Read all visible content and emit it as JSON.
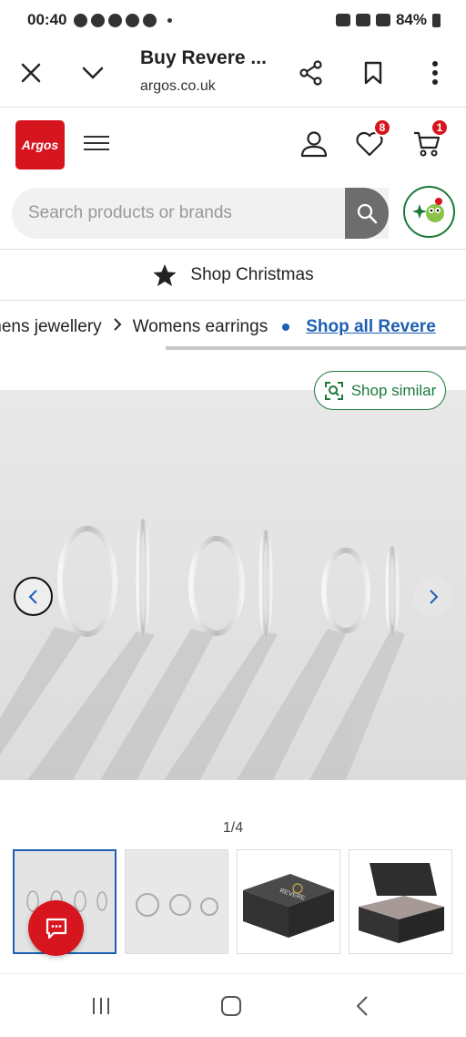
{
  "status_bar": {
    "time": "00:40",
    "battery": "84%"
  },
  "browser": {
    "title": "Buy Revere ...",
    "url": "argos.co.uk"
  },
  "header": {
    "logo_text": "Argos",
    "wishlist_count": "8",
    "basket_count": "1",
    "search_placeholder": "Search products or brands"
  },
  "promo": {
    "label": "Shop Christmas"
  },
  "breadcrumb": {
    "items": [
      "mens jewellery",
      "Womens earrings"
    ],
    "shop_all_link": "Shop all Revere"
  },
  "gallery": {
    "shop_similar_label": "Shop similar",
    "counter": "1/4",
    "thumbnails": [
      "hoops-in-row",
      "hoops-flat",
      "gift-box-closed",
      "gift-box-open"
    ],
    "box_brand": "REVERE"
  },
  "colors": {
    "brand_red": "#d7151e",
    "link_blue": "#1d5fb4",
    "assistant_green": "#1b7a3a"
  }
}
